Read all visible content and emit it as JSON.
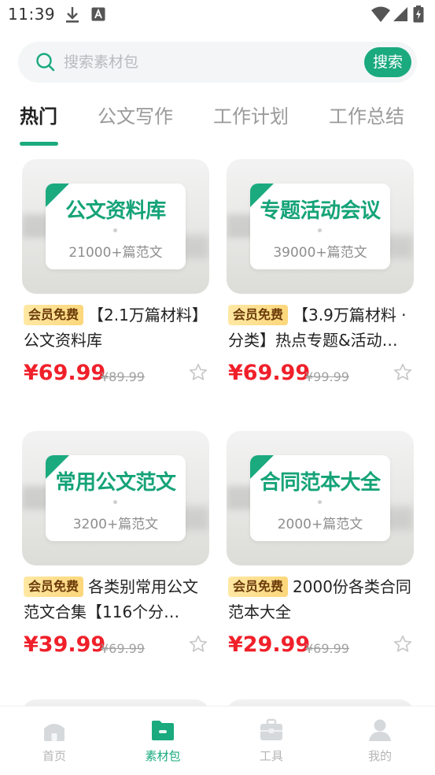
{
  "status": {
    "time": "11:39"
  },
  "search": {
    "placeholder": "搜索素材包",
    "button": "搜索"
  },
  "tabs": [
    {
      "label": "热门"
    },
    {
      "label": "公文写作"
    },
    {
      "label": "工作计划"
    },
    {
      "label": "工作总结"
    }
  ],
  "cards": [
    {
      "cover_title": "公文资料库",
      "cover_sub": "21000+篇范文",
      "badge": "会员免费",
      "title": "【2.1万篇材料】公文资料库",
      "price": "¥69.99",
      "original_price": "¥89.99"
    },
    {
      "cover_title": "专题活动会议",
      "cover_sub": "39000+篇范文",
      "badge": "会员免费",
      "title": "【3.9万篇材料 · 分类】热点专题&活动…",
      "price": "¥69.99",
      "original_price": "¥99.99"
    },
    {
      "cover_title": "常用公文范文",
      "cover_sub": "3200+篇范文",
      "badge": "会员免费",
      "title": "各类别常用公文范文合集【116个分…",
      "price": "¥39.99",
      "original_price": "¥69.99"
    },
    {
      "cover_title": "合同范本大全",
      "cover_sub": "2000+篇范文",
      "badge": "会员免费",
      "title": "2000份各类合同范本大全",
      "price": "¥29.99",
      "original_price": "¥69.99"
    }
  ],
  "bottom_nav": [
    {
      "label": "首页",
      "icon": "home-icon"
    },
    {
      "label": "素材包",
      "icon": "folder-icon"
    },
    {
      "label": "工具",
      "icon": "toolbox-icon"
    },
    {
      "label": "我的",
      "icon": "user-icon"
    }
  ],
  "colors": {
    "accent": "#1aaa7e",
    "price": "#f0202a",
    "badge": "#fcd67a"
  }
}
